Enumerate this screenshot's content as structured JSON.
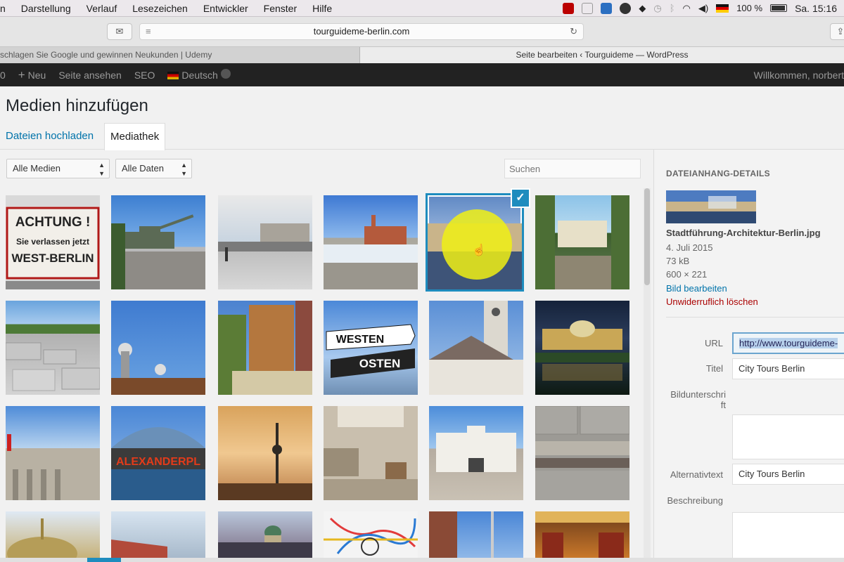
{
  "menubar": {
    "items": [
      "n",
      "Darstellung",
      "Verlauf",
      "Lesezeichen",
      "Entwickler",
      "Fenster",
      "Hilfe"
    ],
    "battery": "100 %",
    "clock": "Sa. 15:16"
  },
  "toolbar": {
    "url": "tourguideme-berlin.com"
  },
  "tabs": {
    "tab1": "schlagen Sie Google und gewinnen Neukunden | Udemy",
    "tab2": "Seite bearbeiten ‹ Tourguideme — WordPress"
  },
  "adminbar": {
    "new": "Neu",
    "view_page": "Seite ansehen",
    "seo": "SEO",
    "language": "Deutsch",
    "welcome": "Willkommen, norbert"
  },
  "modal": {
    "title": "Medien hinzufügen",
    "tab_upload": "Dateien hochladen",
    "tab_library": "Mediathek",
    "filter_media": "Alle Medien",
    "filter_dates": "Alle Daten",
    "search_placeholder": "Suchen"
  },
  "tile_texts": {
    "achtung_1": "ACHTUNG !",
    "achtung_2": "Sie verlassen jetzt",
    "achtung_3": "WEST-BERLIN",
    "westen": "WESTEN",
    "osten": "OSTEN",
    "alexanderplatz": "ALEXANDERPL"
  },
  "details": {
    "heading": "DATEIANHANG-DETAILS",
    "filename": "Stadtführung-Architektur-Berlin.jpg",
    "date": "4. Juli 2015",
    "size": "73 kB",
    "dimensions": "600 × 221",
    "edit_link": "Bild bearbeiten",
    "delete_link": "Unwiderruflich löschen",
    "url_label": "URL",
    "url_value": "http://www.tourguideme-",
    "title_label": "Titel",
    "title_value": "City Tours Berlin",
    "caption_label_1": "Bildunterschri",
    "caption_label_2": "ft",
    "alt_label": "Alternativtext",
    "alt_value": "City Tours Berlin",
    "description_label": "Beschreibung"
  }
}
